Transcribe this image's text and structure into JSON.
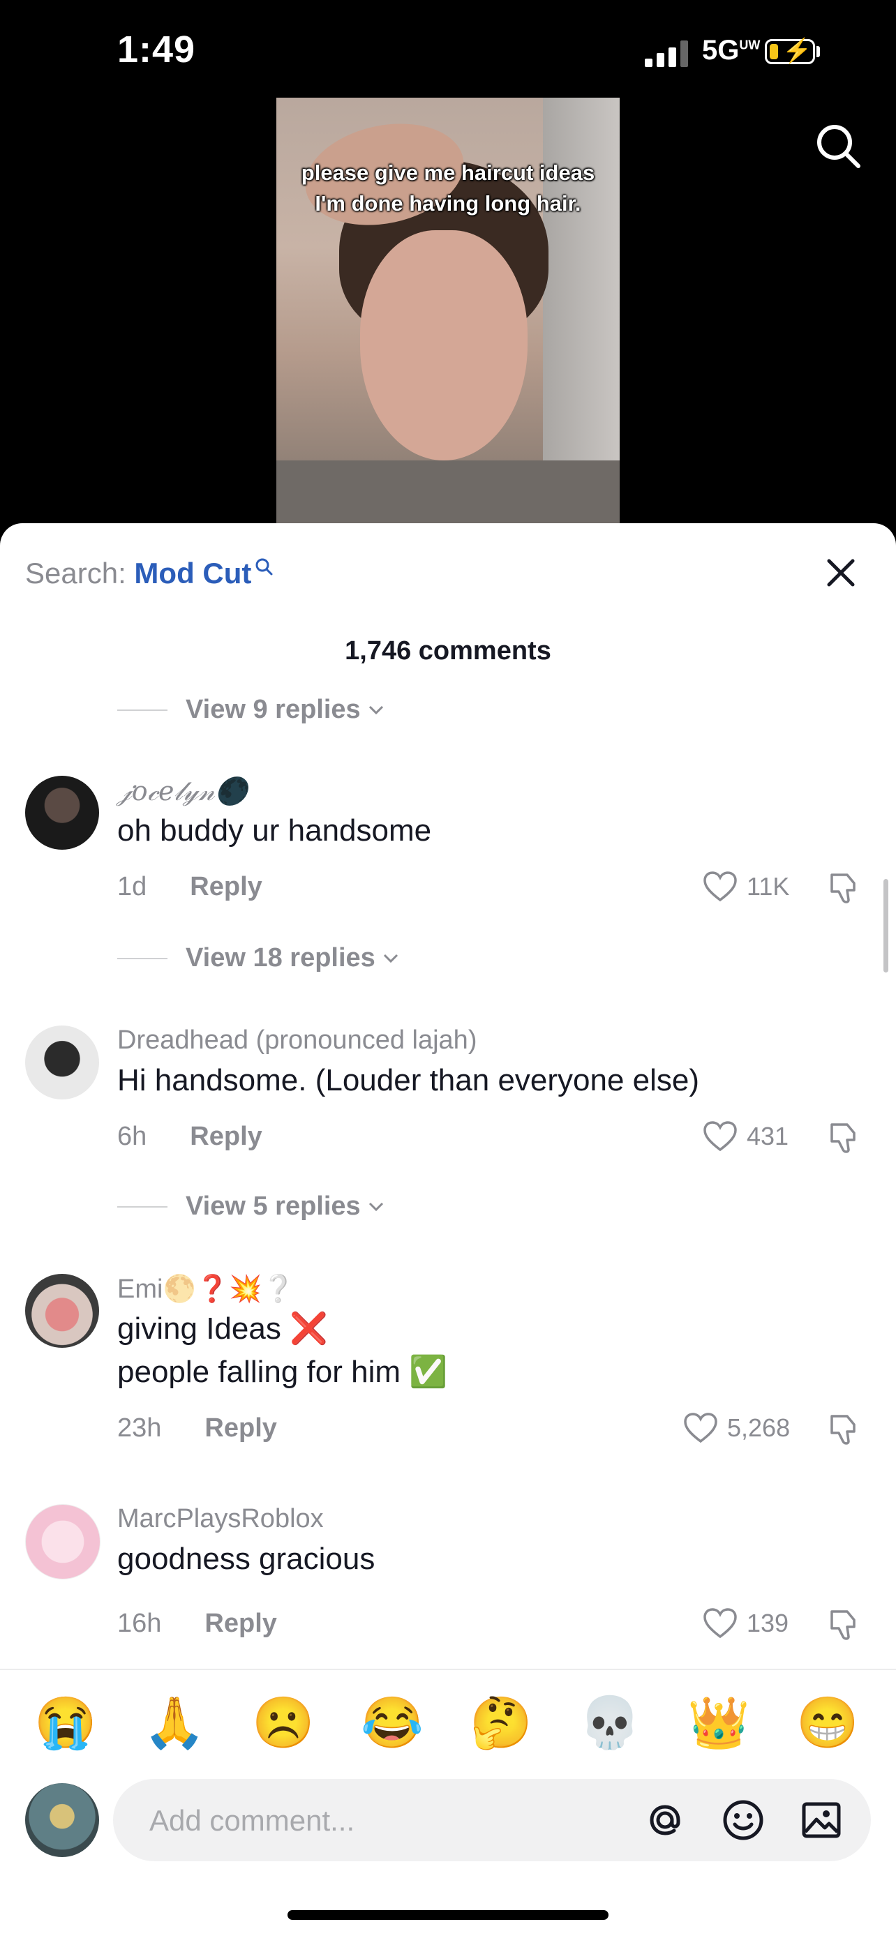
{
  "status_bar": {
    "time": "1:49",
    "network": "5G",
    "network_sup": "UW"
  },
  "video": {
    "caption_line1": "please give me haircut ideas",
    "caption_line2": "I'm done having long hair."
  },
  "sheet": {
    "search_prefix": "Search: ",
    "search_term": "Mod Cut",
    "comment_count": "1,746 comments"
  },
  "replies": [
    {
      "label": "View 9 replies"
    },
    {
      "label": "View 18 replies"
    },
    {
      "label": "View 5 replies"
    }
  ],
  "comments": [
    {
      "username": "𝒿𝑜𝒸𝑒𝓁𝓎𝓃🌑",
      "text": "oh buddy ur handsome",
      "age": "1d",
      "reply": "Reply",
      "likes": "11K"
    },
    {
      "username": "Dreadhead (pronounced lajah)",
      "text": "Hi handsome. (Louder than everyone else)",
      "age": "6h",
      "reply": "Reply",
      "likes": "431"
    },
    {
      "username": "Emi🌕❓💥❔",
      "text_line1": "giving Ideas ❌",
      "text_line2": "people falling for him ✅",
      "age": "23h",
      "reply": "Reply",
      "likes": "5,268"
    },
    {
      "username": "MarcPlaysRoblox",
      "text": "goodness gracious",
      "age": "16h",
      "reply": "Reply",
      "likes": "139"
    }
  ],
  "emoji_bar": [
    "😭",
    "🙏",
    "☹️",
    "😂",
    "🤔",
    "💀",
    "👑",
    "😁"
  ],
  "composer": {
    "placeholder": "Add comment..."
  },
  "colors": {
    "accent_link": "#2b5db9",
    "text_primary": "#161823",
    "text_secondary": "#8a8b91"
  }
}
